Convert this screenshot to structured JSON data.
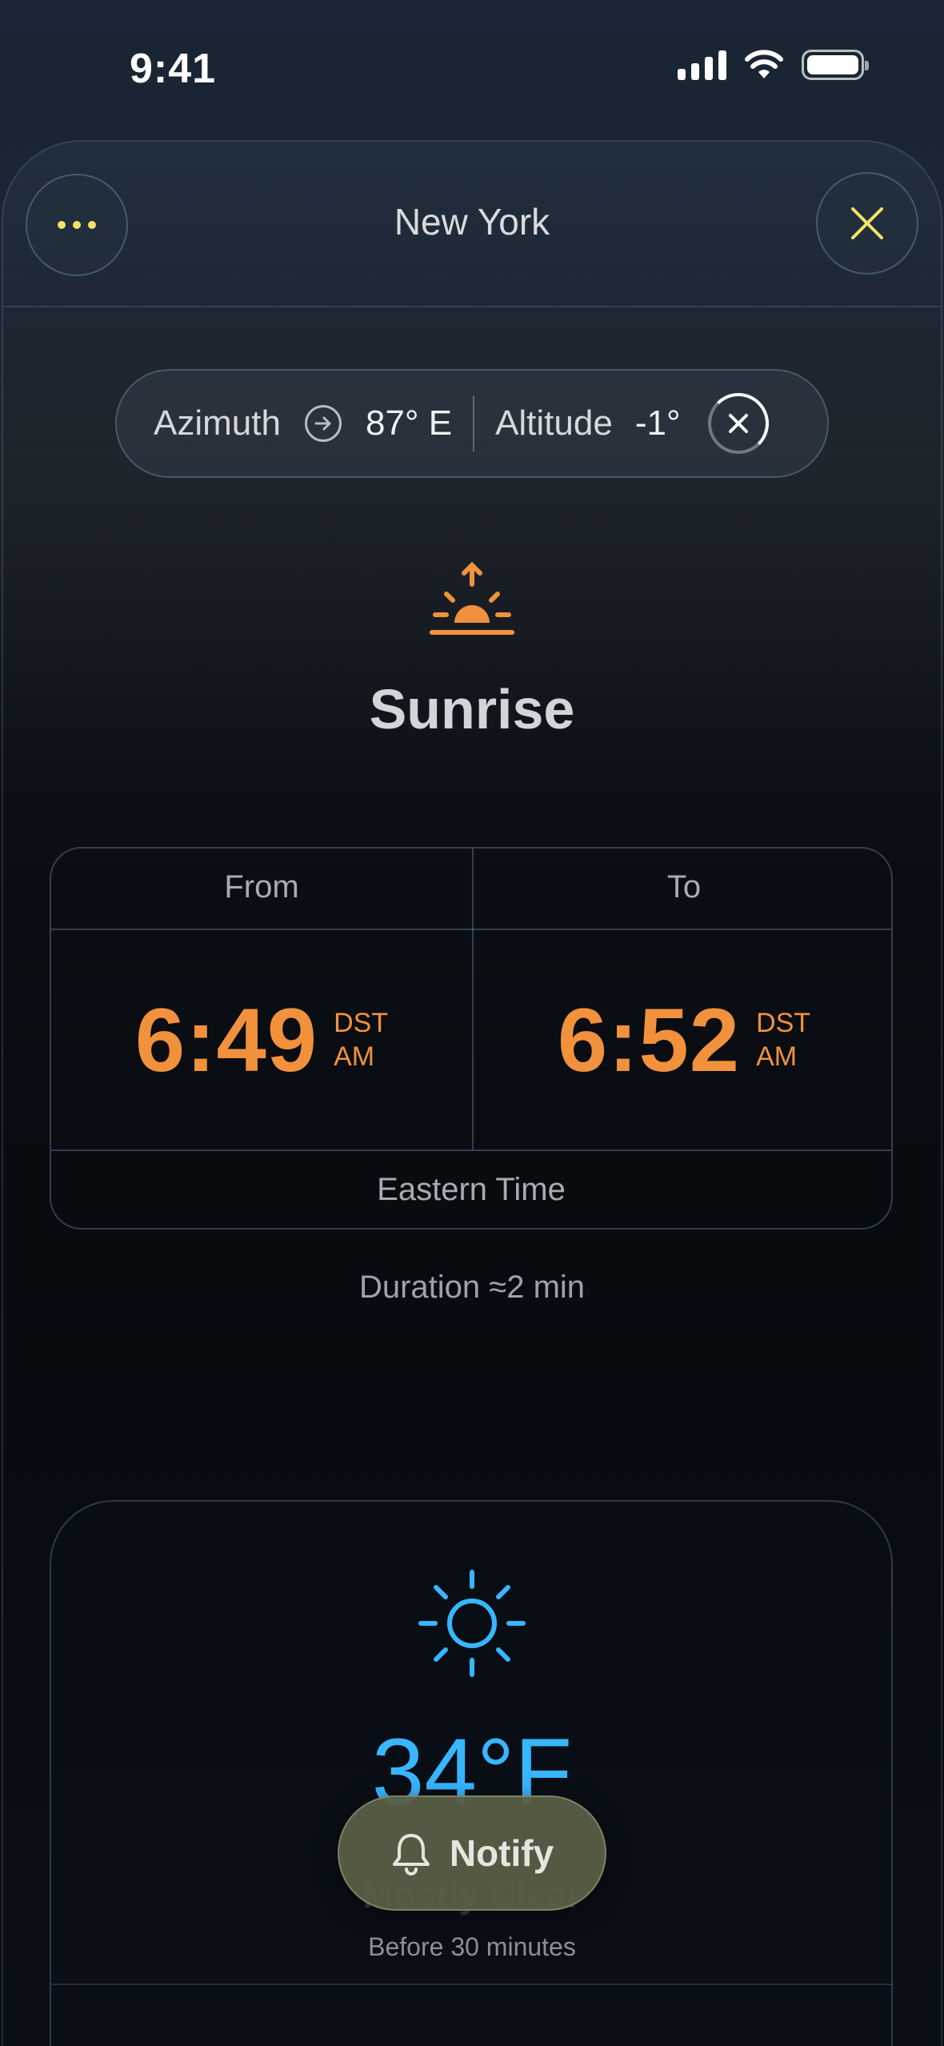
{
  "status_bar": {
    "time": "9:41"
  },
  "header": {
    "title": "New York"
  },
  "position": {
    "azimuth_label": "Azimuth",
    "azimuth_value": "87° E",
    "altitude_label": "Altitude",
    "altitude_value": "-1°"
  },
  "event": {
    "title": "Sunrise",
    "from_label": "From",
    "to_label": "To",
    "from_time": "6:49",
    "from_zone": "DST",
    "from_period": "AM",
    "to_time": "6:52",
    "to_zone": "DST",
    "to_period": "AM",
    "timezone": "Eastern Time",
    "duration": "Duration ≈2 min"
  },
  "weather": {
    "temperature": "34°F",
    "condition": "Mostly Clear",
    "timing": "Before 30 minutes"
  },
  "notify": {
    "label": "Notify"
  },
  "colors": {
    "accent_orange": "#f2913c",
    "accent_blue": "#38b6ff",
    "accent_yellow": "#f2e36a"
  },
  "icons": [
    "more-icon",
    "close-icon",
    "arrow-right-circle-icon",
    "clear-icon",
    "sunrise-icon",
    "sun-icon",
    "bell-icon"
  ]
}
